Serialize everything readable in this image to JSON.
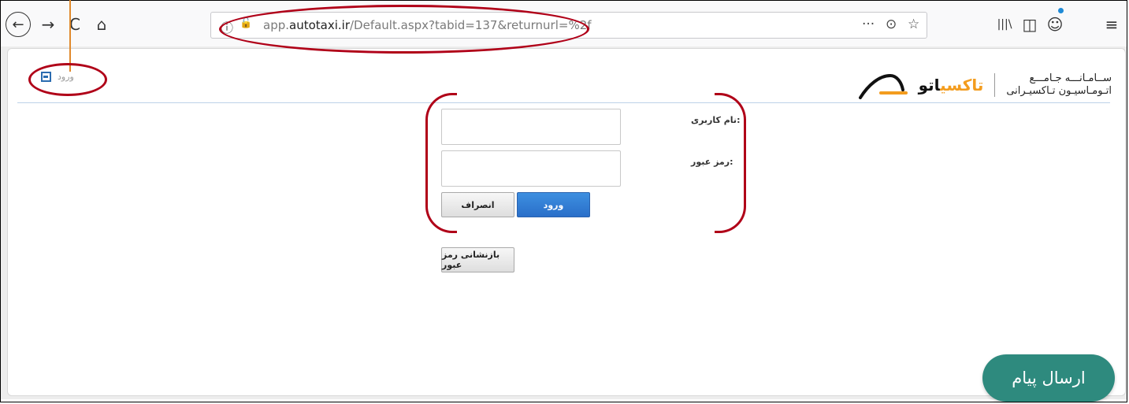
{
  "browser": {
    "url_prefix": "app.",
    "url_domain": "autotaxi.ir",
    "url_path": "/Default.aspx?tabid=137&returnurl=%2f",
    "back_glyph": "←",
    "forward_glyph": "→",
    "reload_glyph": "C",
    "home_glyph": "⌂",
    "more_glyph": "···",
    "pocket_glyph": "⊙",
    "star_glyph": "☆",
    "library_glyph": "|||\\",
    "sidebar_glyph": "◫",
    "account_glyph": "☺",
    "menu_glyph": "≡",
    "info_glyph": "ⓘ",
    "insecure_glyph": "🔓"
  },
  "header": {
    "login_link_label": "ورود",
    "brand_line1": "ســامـانـــه جـامـــع",
    "brand_line2": "اتـومـاسیـون تـاکسیـرانی",
    "brand_name_dark": "اتو",
    "brand_name_orange": "تاکسی"
  },
  "form": {
    "username_label": "نام کاربری:",
    "password_label": "رمز عبور:",
    "login_button": "ورود",
    "cancel_button": "انصراف",
    "reset_password_button": "بازنشانی رمز عبور"
  },
  "chat": {
    "send_message_button": "ارسال پیام"
  },
  "colors": {
    "annotation": "#b00018",
    "accent_blue": "#2a6fc9",
    "brand_orange": "#f39c1e",
    "chat_teal": "#2e8a7e"
  }
}
